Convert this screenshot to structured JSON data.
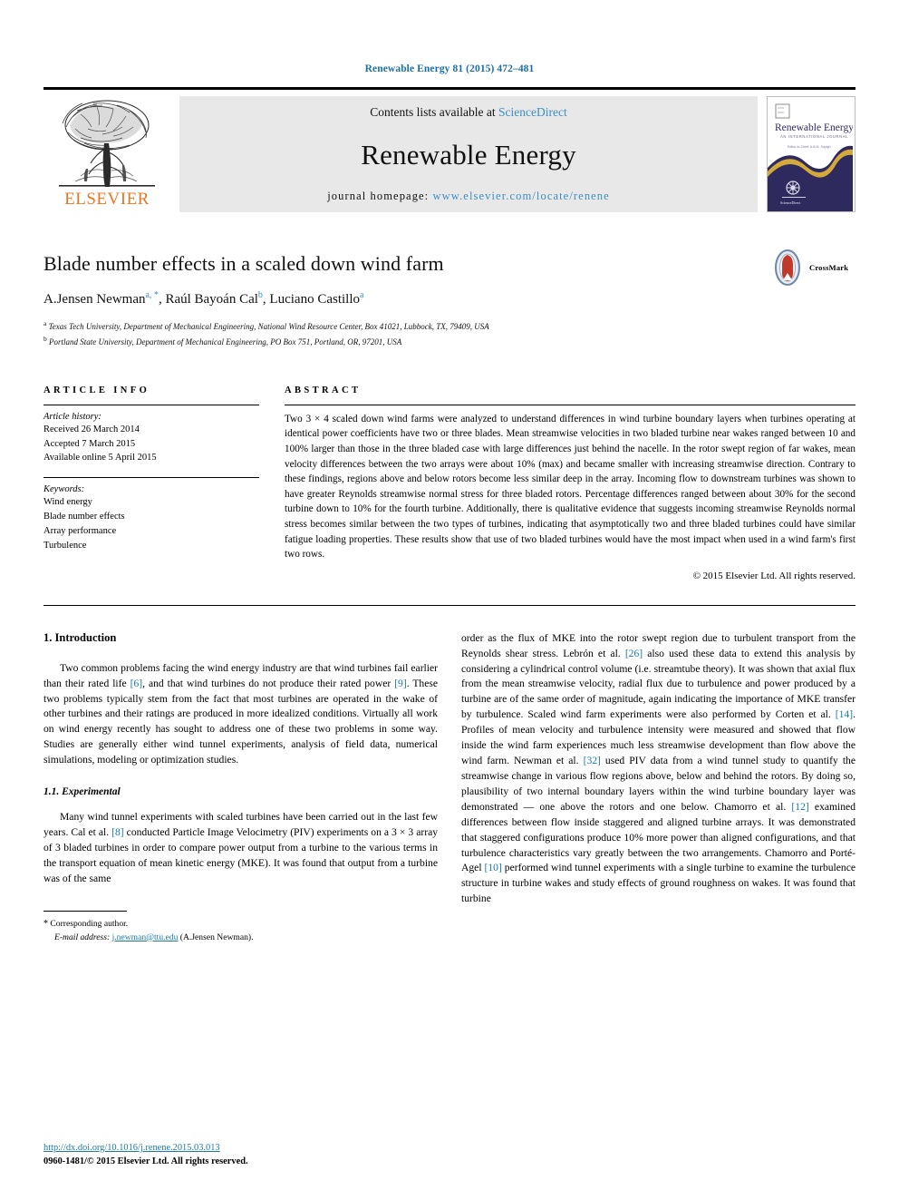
{
  "running_head": "Renewable Energy 81 (2015) 472–481",
  "masthead": {
    "publisher": "ELSEVIER",
    "contents_prefix": "Contents lists available at",
    "contents_link": "ScienceDirect",
    "journal_title": "Renewable Energy",
    "homepage_prefix": "journal homepage:",
    "homepage_url": "www.elsevier.com/locate/renene",
    "cover_title": "Renewable Energy",
    "cover_subtitle": "AN INTERNATIONAL JOURNAL",
    "cover_line3": "Editor-in-Chief: A.A.M. Sayigh",
    "cover_footer": "ScienceDirect"
  },
  "article": {
    "title": "Blade number effects in a scaled down wind farm",
    "authors": [
      {
        "name": "A.Jensen Newman",
        "marks": "a, *"
      },
      {
        "name": "Raúl Bayoán Cal",
        "marks": "b"
      },
      {
        "name": "Luciano Castillo",
        "marks": "a"
      }
    ],
    "affiliations": [
      {
        "mark": "a",
        "text": "Texas Tech University, Department of Mechanical Engineering, National Wind Resource Center, Box 41021, Lubbock, TX, 79409, USA"
      },
      {
        "mark": "b",
        "text": "Portland State University, Department of Mechanical Engineering, PO Box 751, Portland, OR, 97201, USA"
      }
    ],
    "crossmark_label": "CrossMark"
  },
  "article_info": {
    "heading": "ARTICLE INFO",
    "history_label": "Article history:",
    "history": [
      "Received 26 March 2014",
      "Accepted 7 March 2015",
      "Available online 5 April 2015"
    ],
    "keywords_label": "Keywords:",
    "keywords": [
      "Wind energy",
      "Blade number effects",
      "Array performance",
      "Turbulence"
    ]
  },
  "abstract": {
    "heading": "ABSTRACT",
    "text": "Two 3 × 4 scaled down wind farms were analyzed to understand differences in wind turbine boundary layers when turbines operating at identical power coefficients have two or three blades. Mean streamwise velocities in two bladed turbine near wakes ranged between 10 and 100% larger than those in the three bladed case with large differences just behind the nacelle. In the rotor swept region of far wakes, mean velocity differences between the two arrays were about 10% (max) and became smaller with increasing streamwise direction. Contrary to these findings, regions above and below rotors become less similar deep in the array. Incoming flow to downstream turbines was shown to have greater Reynolds streamwise normal stress for three bladed rotors. Percentage differences ranged between about 30% for the second turbine down to 10% for the fourth turbine. Additionally, there is qualitative evidence that suggests incoming streamwise Reynolds normal stress becomes similar between the two types of turbines, indicating that asymptotically two and three bladed turbines could have similar fatigue loading properties. These results show that use of two bladed turbines would have the most impact when used in a wind farm's first two rows.",
    "copyright": "© 2015 Elsevier Ltd. All rights reserved."
  },
  "body": {
    "section1_heading": "1. Introduction",
    "p1_a": "Two common problems facing the wind energy industry are that wind turbines fail earlier than their rated life ",
    "p1_ref1": "[6]",
    "p1_b": ", and that wind turbines do not produce their rated power ",
    "p1_ref2": "[9]",
    "p1_c": ". These two problems typically stem from the fact that most turbines are operated in the wake of other turbines and their ratings are produced in more idealized conditions. Virtually all work on wind energy recently has sought to address one of these two problems in some way. Studies are generally either wind tunnel experiments, analysis of field data, numerical simulations, modeling or optimization studies.",
    "subsection11_heading": "1.1. Experimental",
    "p2_a": "Many wind tunnel experiments with scaled turbines have been carried out in the last few years. Cal et al. ",
    "p2_ref1": "[8]",
    "p2_b": " conducted Particle Image Velocimetry (PIV) experiments on a 3 × 3 array of 3 bladed turbines in order to compare power output from a turbine to the various terms in the transport equation of mean kinetic energy (MKE). It was found that output from a turbine was of the same",
    "p3_a": "order as the flux of MKE into the rotor swept region due to turbulent transport from the Reynolds shear stress. Lebrón et al. ",
    "p3_ref1": "[26]",
    "p3_b": " also used these data to extend this analysis by considering a cylindrical control volume (i.e. streamtube theory). It was shown that axial flux from the mean streamwise velocity, radial flux due to turbulence and power produced by a turbine are of the same order of magnitude, again indicating the importance of MKE transfer by turbulence. Scaled wind farm experiments were also performed by Corten et al. ",
    "p3_ref2": "[14]",
    "p3_c": ". Profiles of mean velocity and turbulence intensity were measured and showed that flow inside the wind farm experiences much less streamwise development than flow above the wind farm. Newman et al. ",
    "p3_ref3": "[32]",
    "p3_d": " used PIV data from a wind tunnel study to quantify the streamwise change in various flow regions above, below and behind the rotors. By doing so, plausibility of two internal boundary layers within the wind turbine boundary layer was demonstrated — one above the rotors and one below. Chamorro et al. ",
    "p3_ref4": "[12]",
    "p3_e": " examined differences between flow inside staggered and aligned turbine arrays. It was demonstrated that staggered configurations produce 10% more power than aligned configurations, and that turbulence characteristics vary greatly between the two arrangements. Chamorro and Porté-Agel ",
    "p3_ref5": "[10]",
    "p3_f": " performed wind tunnel experiments with a single turbine to examine the turbulence structure in turbine wakes and study effects of ground roughness on wakes. It was found that turbine"
  },
  "footnote": {
    "star": "*",
    "corresponding": "Corresponding author.",
    "email_label": "E-mail address:",
    "email": "j.newman@ttu.edu",
    "email_owner": "(A.Jensen Newman)."
  },
  "page_footer": {
    "doi": "http://dx.doi.org/10.1016/j.renene.2015.03.013",
    "issn_line": "0960-1481/© 2015 Elsevier Ltd. All rights reserved."
  },
  "colors": {
    "link": "#1a7aa8",
    "elsevier_orange": "#E87722",
    "band_gray": "#e8e8e8",
    "cover_navy": "#2f2a5e",
    "cover_gold": "#d4a93c"
  }
}
